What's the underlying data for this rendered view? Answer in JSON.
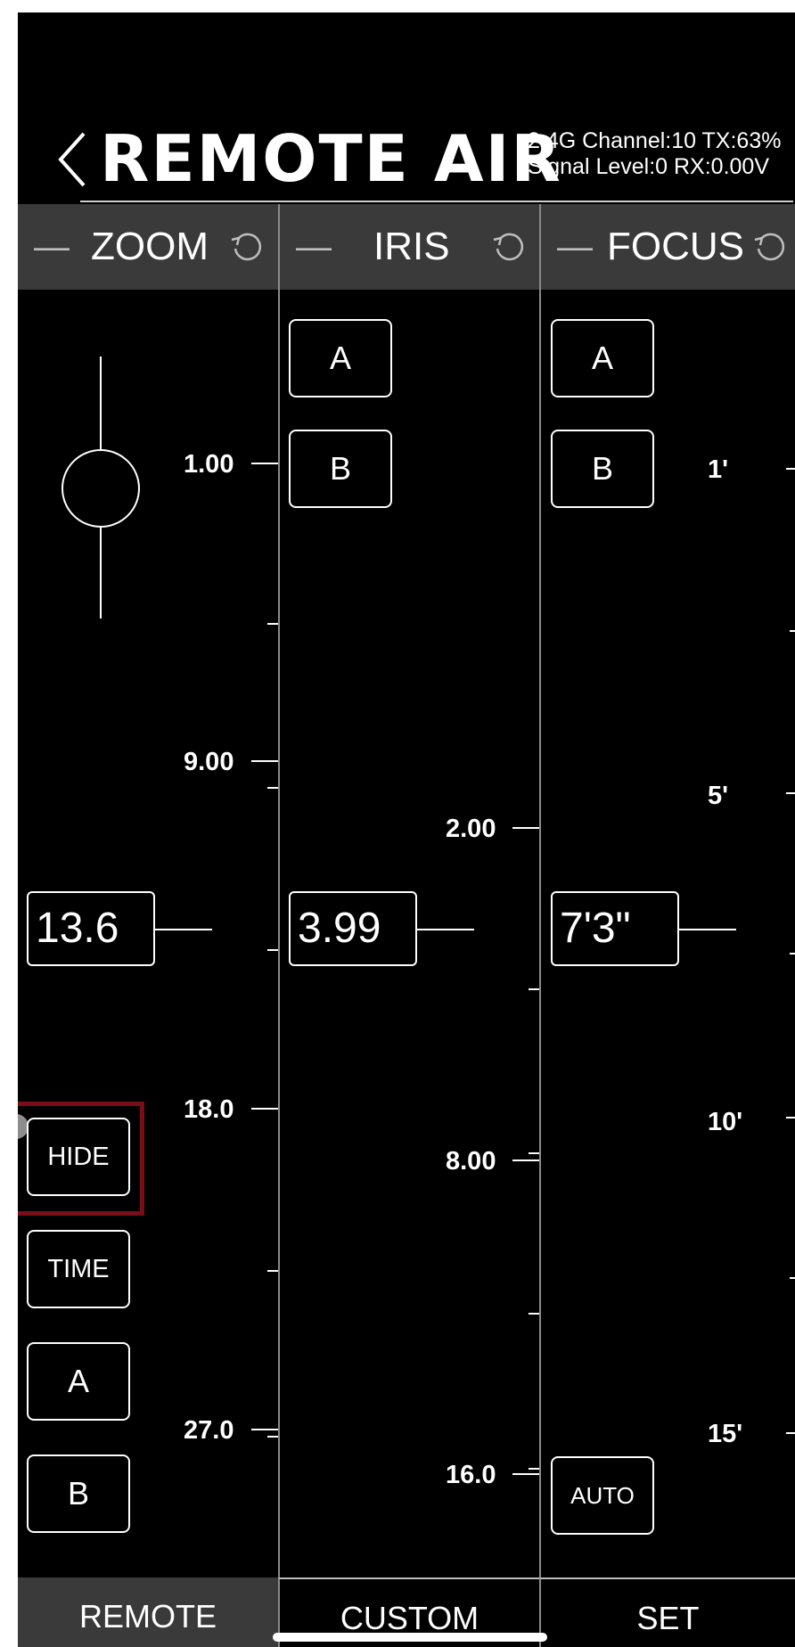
{
  "header": {
    "back_icon": "chevron-left-icon",
    "title": "REMOTE AIR",
    "status_line1": "2.4G Channel:10 TX:63%",
    "status_line2": "Signal Level:0 RX:0.00V"
  },
  "columns": [
    {
      "title": "ZOOM",
      "current_value": "13.6",
      "scale_labels": [
        "1.00",
        "9.00",
        "18.0",
        "27.0"
      ],
      "buttons": [
        "HIDE",
        "TIME",
        "A",
        "B"
      ],
      "slider": "zoom-rocker"
    },
    {
      "title": "IRIS",
      "current_value": "3.99",
      "scale_labels": [
        "2.00",
        "8.00",
        "16.0"
      ],
      "buttons": [
        "A",
        "B"
      ]
    },
    {
      "title": "FOCUS",
      "current_value": "7'3\"",
      "scale_labels": [
        "1'",
        "5'",
        "10'",
        "15'"
      ],
      "buttons": [
        "A",
        "B",
        "AUTO"
      ]
    }
  ],
  "icons": {
    "reset": "reset-icon",
    "minus": "minus-icon"
  },
  "colors": {
    "background": "#000000",
    "header_bar": "#3a3a3a",
    "highlight": "#7a0e18"
  },
  "tabs": [
    "REMOTE",
    "CUSTOM",
    "SET"
  ],
  "active_tab": "REMOTE"
}
